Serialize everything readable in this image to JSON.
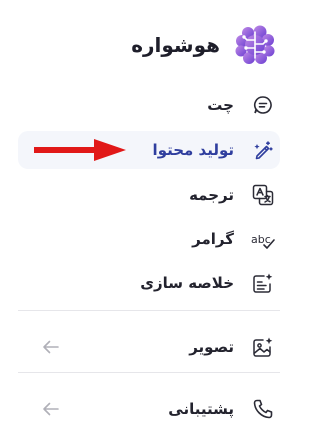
{
  "app": {
    "title": "هوشواره"
  },
  "menu": {
    "chat": "چت",
    "content": "تولید محتوا",
    "translate": "ترجمه",
    "grammar": "گرامر",
    "summary": "خلاصه سازی",
    "image": "تصویر",
    "support": "پشتیبانی"
  },
  "icons": {
    "chat": "chat-bubble-icon",
    "content": "magic-pen-icon",
    "translate": "translate-icon",
    "grammar": "abc-check-icon",
    "summary": "summary-sparkle-icon",
    "image": "image-sparkle-icon",
    "support": "phone-icon",
    "back": "arrow-left-icon"
  },
  "colors": {
    "accent": "#2f3e9e",
    "logo": "#9b59d6",
    "annotation_arrow": "#e11818"
  }
}
